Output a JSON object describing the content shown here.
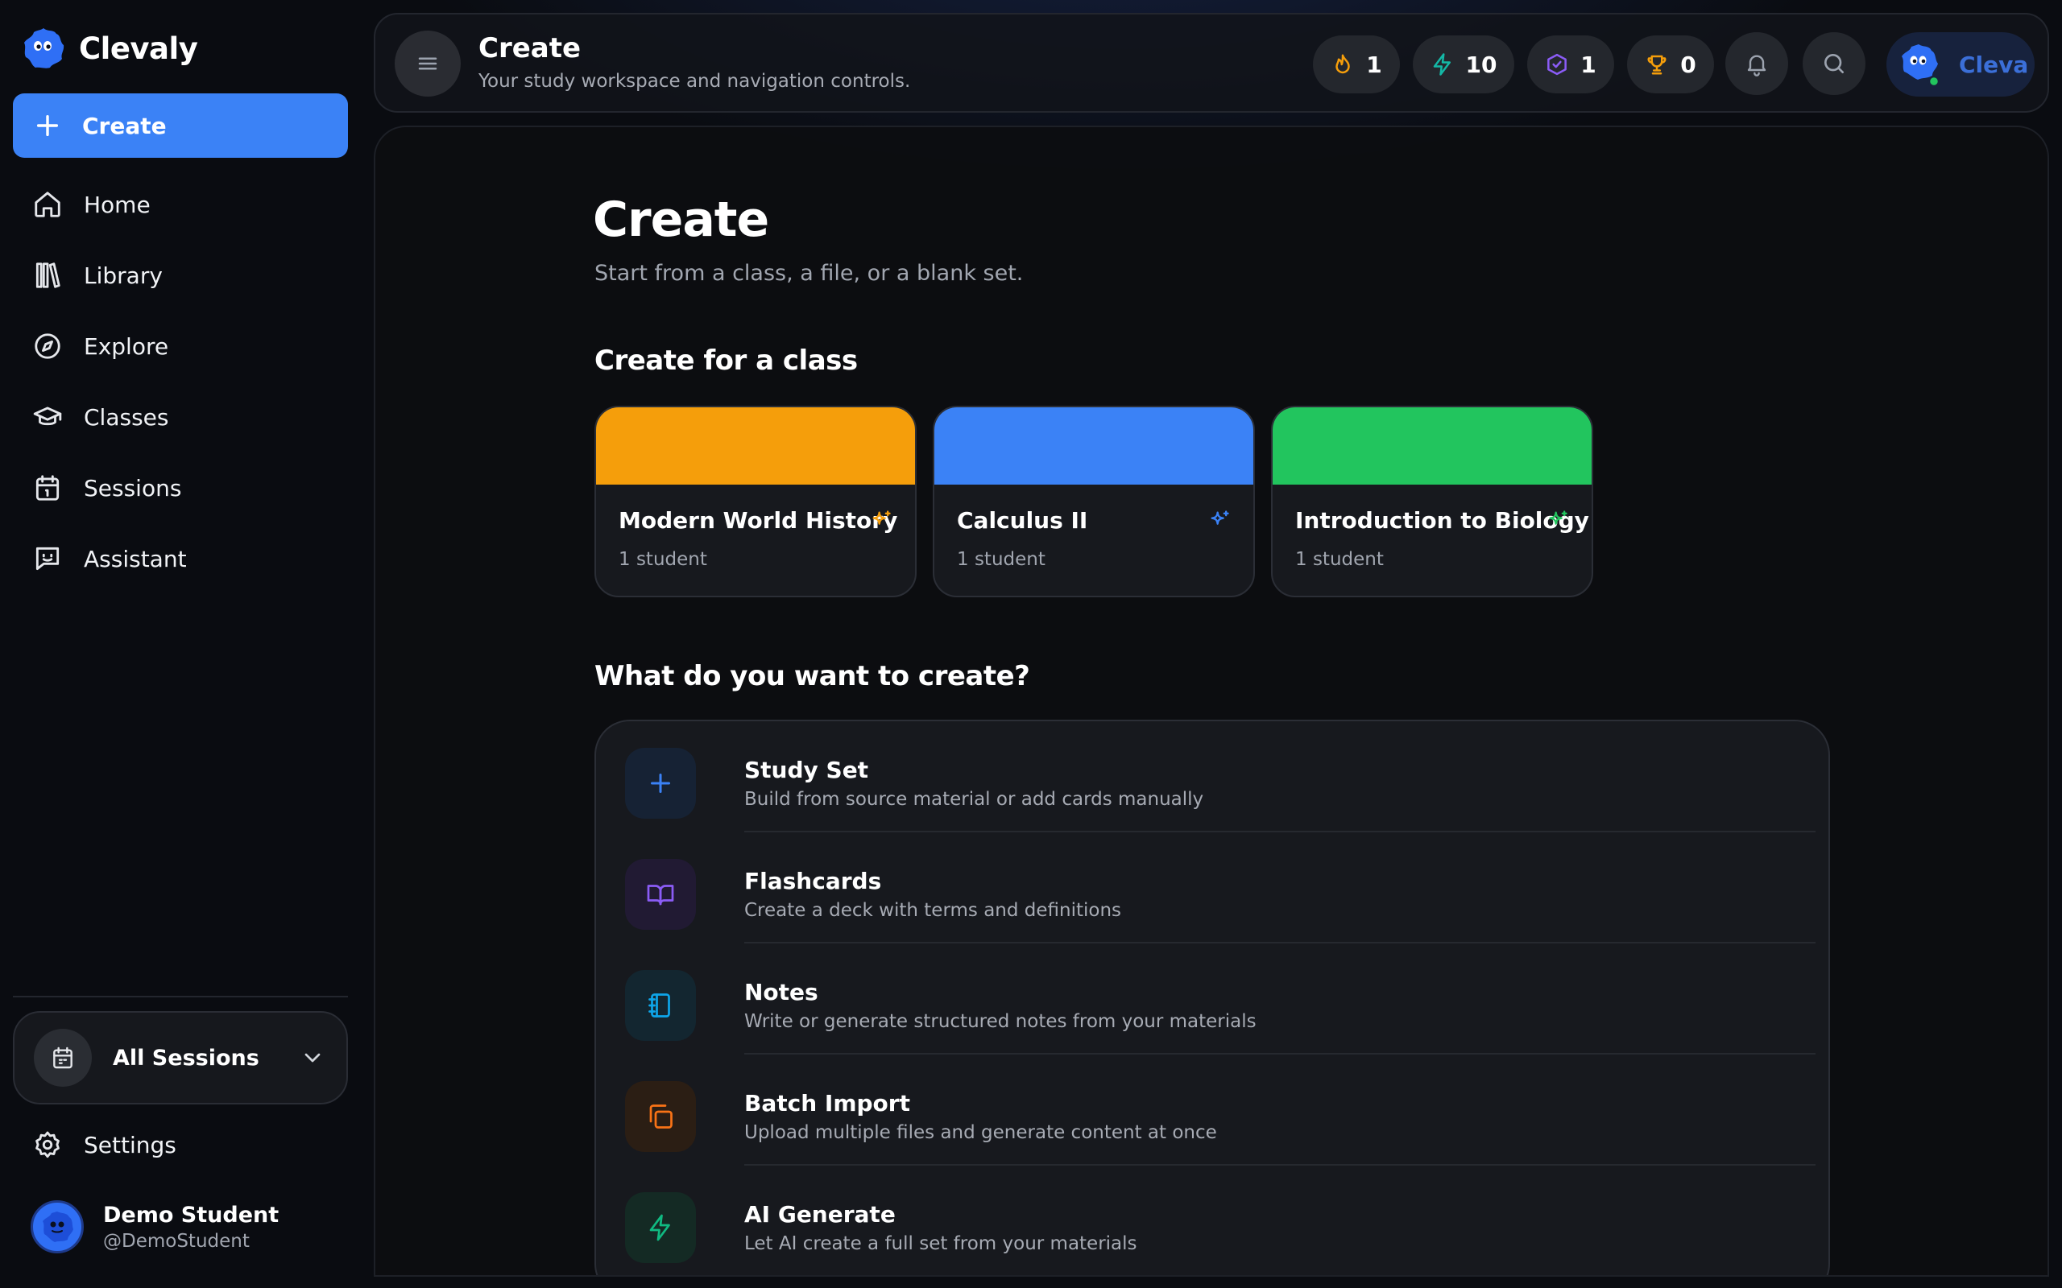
{
  "app": {
    "brand": "Clevaly"
  },
  "sidebar": {
    "create_label": "Create",
    "items": [
      {
        "label": "Home",
        "icon": "home-icon"
      },
      {
        "label": "Library",
        "icon": "library-icon"
      },
      {
        "label": "Explore",
        "icon": "compass-icon"
      },
      {
        "label": "Classes",
        "icon": "graduation-cap-icon"
      },
      {
        "label": "Sessions",
        "icon": "calendar-icon"
      },
      {
        "label": "Assistant",
        "icon": "chat-bot-icon"
      }
    ],
    "sessions_selector": "All Sessions",
    "settings_label": "Settings",
    "user": {
      "name": "Demo Student",
      "handle": "@DemoStudent"
    }
  },
  "topbar": {
    "title": "Create",
    "subtitle": "Your study workspace and navigation controls.",
    "stats": {
      "streak": "1",
      "energy": "10",
      "badges": "1",
      "trophies": "0"
    },
    "profile_label": "Cleva"
  },
  "main": {
    "title": "Create",
    "subtitle": "Start from a class, a file, or a blank set.",
    "classes_heading": "Create for a class",
    "classes": [
      {
        "name": "Modern World History",
        "count": "1 student",
        "color": "#f59e0b"
      },
      {
        "name": "Calculus II",
        "count": "1 student",
        "color": "#3b82f6"
      },
      {
        "name": "Introduction to Biology",
        "count": "1 student",
        "color": "#22c55e"
      }
    ],
    "options_heading": "What do you want to create?",
    "options": [
      {
        "title": "Study Set",
        "desc": "Build from source material or add cards manually",
        "icon": "plus-icon",
        "color": "#3b82f6"
      },
      {
        "title": "Flashcards",
        "desc": "Create a deck with terms and definitions",
        "icon": "book-open-icon",
        "color": "#8b5cf6"
      },
      {
        "title": "Notes",
        "desc": "Write or generate structured notes from your materials",
        "icon": "notebook-icon",
        "color": "#0ea5e9"
      },
      {
        "title": "Batch Import",
        "desc": "Upload multiple files and generate content at once",
        "icon": "copy-icon",
        "color": "#f97316"
      },
      {
        "title": "AI Generate",
        "desc": "Let AI create a full set from your materials",
        "icon": "bolt-icon",
        "color": "#10b981"
      }
    ]
  }
}
